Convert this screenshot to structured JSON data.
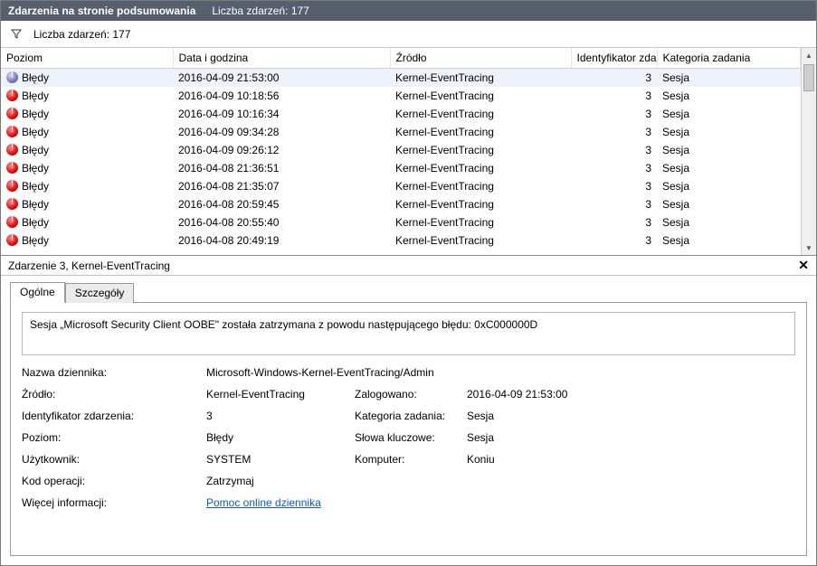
{
  "titlebar": {
    "title": "Zdarzenia na stronie podsumowania",
    "count_label": "Liczba zdarzeń: 177"
  },
  "filterbar": {
    "count_label": "Liczba zdarzeń: 177"
  },
  "columns": {
    "level": "Poziom",
    "date": "Data i godzina",
    "source": "Źródło",
    "id": "Identyfikator zdarzenia",
    "category": "Kategoria zadania"
  },
  "rows": [
    {
      "level": "Błędy",
      "date": "2016-04-09 21:53:00",
      "source": "Kernel-EventTracing",
      "id": "3",
      "cat": "Sesja",
      "sel": true,
      "info": true
    },
    {
      "level": "Błędy",
      "date": "2016-04-09 10:18:56",
      "source": "Kernel-EventTracing",
      "id": "3",
      "cat": "Sesja"
    },
    {
      "level": "Błędy",
      "date": "2016-04-09 10:16:34",
      "source": "Kernel-EventTracing",
      "id": "3",
      "cat": "Sesja"
    },
    {
      "level": "Błędy",
      "date": "2016-04-09 09:34:28",
      "source": "Kernel-EventTracing",
      "id": "3",
      "cat": "Sesja"
    },
    {
      "level": "Błędy",
      "date": "2016-04-09 09:26:12",
      "source": "Kernel-EventTracing",
      "id": "3",
      "cat": "Sesja"
    },
    {
      "level": "Błędy",
      "date": "2016-04-08 21:36:51",
      "source": "Kernel-EventTracing",
      "id": "3",
      "cat": "Sesja"
    },
    {
      "level": "Błędy",
      "date": "2016-04-08 21:35:07",
      "source": "Kernel-EventTracing",
      "id": "3",
      "cat": "Sesja"
    },
    {
      "level": "Błędy",
      "date": "2016-04-08 20:59:45",
      "source": "Kernel-EventTracing",
      "id": "3",
      "cat": "Sesja"
    },
    {
      "level": "Błędy",
      "date": "2016-04-08 20:55:40",
      "source": "Kernel-EventTracing",
      "id": "3",
      "cat": "Sesja"
    },
    {
      "level": "Błędy",
      "date": "2016-04-08 20:49:19",
      "source": "Kernel-EventTracing",
      "id": "3",
      "cat": "Sesja"
    }
  ],
  "detail": {
    "header": "Zdarzenie 3, Kernel-EventTracing",
    "tabs": {
      "general": "Ogólne",
      "details": "Szczegóły"
    },
    "message": "Sesja „Microsoft Security Client OOBE\" została zatrzymana z powodu następującego błędu: 0xC000000D",
    "labels": {
      "logname": "Nazwa dziennika:",
      "source": "Źródło:",
      "logged": "Zalogowano:",
      "eventid": "Identyfikator zdarzenia:",
      "category": "Kategoria zadania:",
      "level": "Poziom:",
      "keywords": "Słowa kluczowe:",
      "user": "Użytkownik:",
      "computer": "Komputer:",
      "opcode": "Kod operacji:",
      "moreinfo": "Więcej informacji:"
    },
    "values": {
      "logname": "Microsoft-Windows-Kernel-EventTracing/Admin",
      "source": "Kernel-EventTracing",
      "logged": "2016-04-09 21:53:00",
      "eventid": "3",
      "category": "Sesja",
      "level": "Błędy",
      "keywords": "Sesja",
      "user": "SYSTEM",
      "computer": "Koniu",
      "opcode": "Zatrzymaj",
      "helplink": "Pomoc online dziennika"
    }
  }
}
